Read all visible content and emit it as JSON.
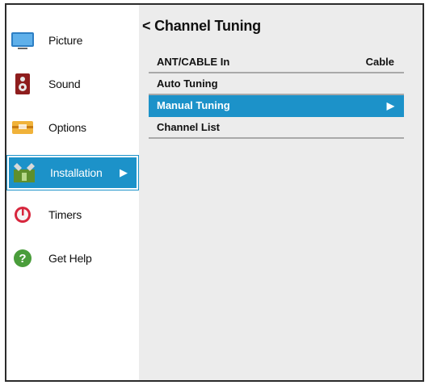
{
  "sidebar": {
    "items": [
      {
        "label": "Picture",
        "icon": "tv-screen-icon"
      },
      {
        "label": "Sound",
        "icon": "speaker-icon"
      },
      {
        "label": "Options",
        "icon": "options-box-icon"
      },
      {
        "label": "Installation",
        "icon": "installation-icon",
        "selected": true,
        "arrow": "▶"
      },
      {
        "label": "Timers",
        "icon": "timer-icon"
      },
      {
        "label": "Get Help",
        "icon": "help-icon"
      }
    ]
  },
  "main": {
    "title": "< Channel Tuning",
    "rows": [
      {
        "label": "ANT/CABLE In",
        "value": "Cable"
      },
      {
        "label": "Auto Tuning",
        "value": ""
      },
      {
        "label": "Manual Tuning",
        "arrow": "▶",
        "selected": true
      },
      {
        "label": "Channel List",
        "value": ""
      }
    ]
  },
  "colors": {
    "accent": "#1c92c9",
    "panel_bg": "#ececec",
    "sidebar_bg": "#ffffff",
    "divider": "#a9a9a9"
  }
}
